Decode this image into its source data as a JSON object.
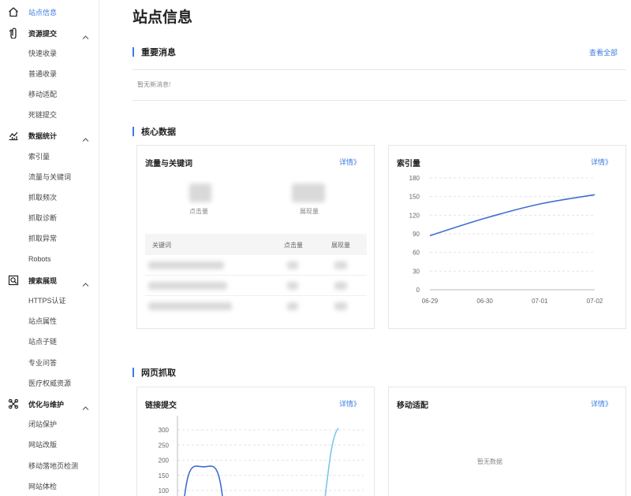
{
  "sidebar": {
    "rows": [
      {
        "label": "站点信息",
        "kind": "item",
        "icon": "home-icon",
        "active": true
      },
      {
        "label": "资源提交",
        "kind": "group",
        "icon": "upload-icon"
      },
      {
        "label": "快速收录",
        "kind": "item"
      },
      {
        "label": "普通收录",
        "kind": "item"
      },
      {
        "label": "移动适配",
        "kind": "item"
      },
      {
        "label": "死链提交",
        "kind": "item"
      },
      {
        "label": "数据统计",
        "kind": "group",
        "icon": "stats-icon"
      },
      {
        "label": "索引量",
        "kind": "item"
      },
      {
        "label": "流量与关键词",
        "kind": "item"
      },
      {
        "label": "抓取频次",
        "kind": "item"
      },
      {
        "label": "抓取诊断",
        "kind": "item"
      },
      {
        "label": "抓取异常",
        "kind": "item"
      },
      {
        "label": "Robots",
        "kind": "item"
      },
      {
        "label": "搜索展现",
        "kind": "group",
        "icon": "search-display-icon"
      },
      {
        "label": "HTTPS认证",
        "kind": "item"
      },
      {
        "label": "站点属性",
        "kind": "item"
      },
      {
        "label": "站点子链",
        "kind": "item"
      },
      {
        "label": "专业问答",
        "kind": "item"
      },
      {
        "label": "医疗权威资源",
        "kind": "item"
      },
      {
        "label": "优化与维护",
        "kind": "group",
        "icon": "tools-icon"
      },
      {
        "label": "闭站保护",
        "kind": "item"
      },
      {
        "label": "网站改版",
        "kind": "item"
      },
      {
        "label": "移动落地页检测",
        "kind": "item"
      },
      {
        "label": "网站体检",
        "kind": "item"
      }
    ]
  },
  "page": {
    "title": "站点信息"
  },
  "messages": {
    "title": "重要消息",
    "view_all": "查看全部",
    "empty": "暂无新消息!"
  },
  "core": {
    "title": "核心数据",
    "traffic": {
      "title": "流量与关键词",
      "detail": "详情》",
      "clicks_label": "点击量",
      "impressions_label": "展现量",
      "columns": [
        "关键词",
        "点击量",
        "展现量"
      ]
    },
    "index": {
      "title": "索引量",
      "detail": "详情》"
    }
  },
  "crawl": {
    "title": "网页抓取",
    "links": {
      "title": "链接提交",
      "detail": "详情》"
    },
    "mobile": {
      "title": "移动适配",
      "detail": "详情》",
      "empty": "暂无数据"
    }
  },
  "colors": {
    "accent": "#3a7de0",
    "line_dark": "#3d6fd0",
    "line_light": "#7cc4ea"
  },
  "chart_data": [
    {
      "type": "line",
      "title": "索引量",
      "x": [
        "06-29",
        "06-30",
        "07-01",
        "07-02"
      ],
      "series": [
        {
          "values": [
            87,
            115,
            138,
            153
          ]
        }
      ],
      "ylim": [
        0,
        180
      ],
      "yticks": [
        0,
        30,
        60,
        90,
        120,
        150,
        180
      ],
      "grid": true
    },
    {
      "type": "line",
      "title": "链接提交",
      "yticks": [
        100,
        150,
        200,
        250,
        300
      ],
      "ylim": [
        100,
        350
      ],
      "grid": true,
      "series": [
        {
          "values": [
            0,
            178,
            0
          ]
        },
        {
          "values": [
            0,
            305
          ]
        }
      ]
    }
  ]
}
